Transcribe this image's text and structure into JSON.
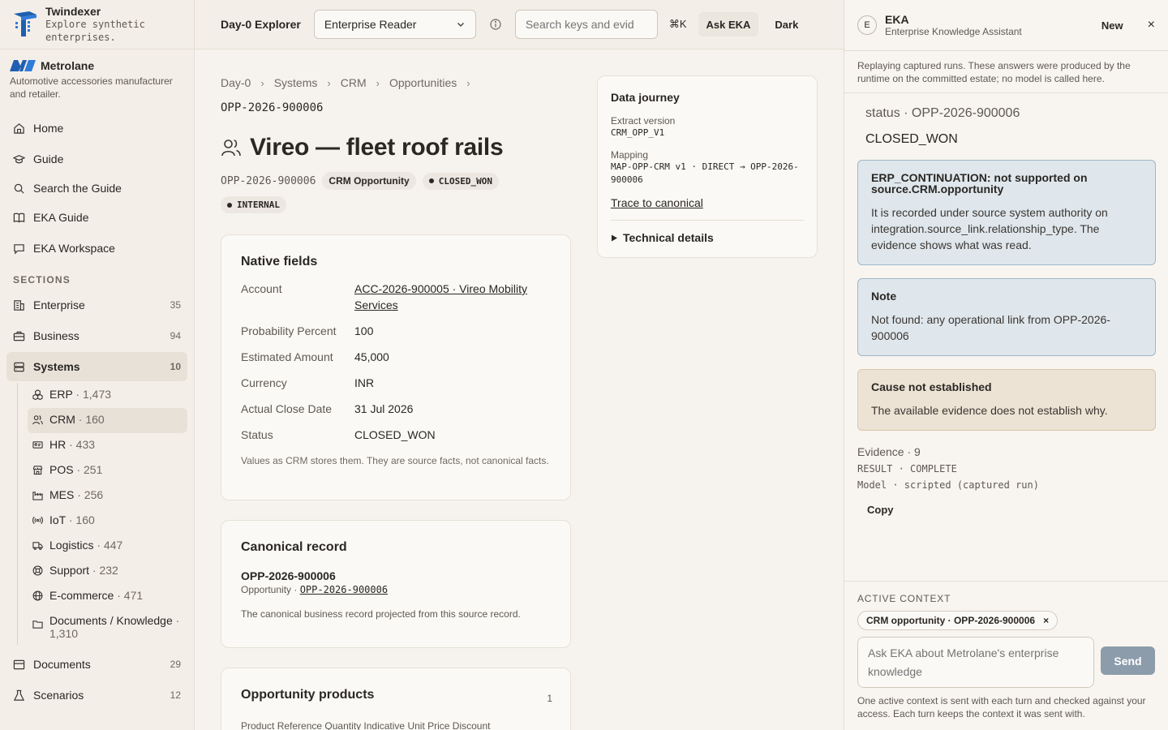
{
  "brand": {
    "name": "Twindexer",
    "tagline": "Explore synthetic enterprises."
  },
  "org": {
    "name": "Metrolane",
    "description": "Automotive accessories manufacturer and retailer."
  },
  "nav": {
    "home": "Home",
    "guide": "Guide",
    "search_guide": "Search the Guide",
    "eka_guide": "EKA Guide",
    "eka_workspace": "EKA Workspace"
  },
  "sections_label": "SECTIONS",
  "sections": [
    {
      "label": "Enterprise",
      "count": "35"
    },
    {
      "label": "Business",
      "count": "94"
    },
    {
      "label": "Systems",
      "count": "10"
    }
  ],
  "systems": [
    {
      "label": "ERP",
      "meta": " · 1,473"
    },
    {
      "label": "CRM",
      "meta": " · 160"
    },
    {
      "label": "HR",
      "meta": " · 433"
    },
    {
      "label": "POS",
      "meta": " · 251"
    },
    {
      "label": "MES",
      "meta": " · 256"
    },
    {
      "label": "IoT",
      "meta": " · 160"
    },
    {
      "label": "Logistics",
      "meta": " · 447"
    },
    {
      "label": "Support",
      "meta": " · 232"
    },
    {
      "label": "E-commerce",
      "meta": " · 471"
    },
    {
      "label": "Documents / Knowledge",
      "meta": " · 1,310"
    }
  ],
  "bottom_sections": [
    {
      "label": "Documents",
      "count": "29"
    },
    {
      "label": "Scenarios",
      "count": "12"
    }
  ],
  "topbar": {
    "title": "Day-0 Explorer",
    "persona": "Enterprise Reader",
    "search_placeholder": "Search keys and evid",
    "shortcut": "⌘K",
    "ask": "Ask EKA",
    "theme": "Dark"
  },
  "breadcrumb": [
    "Day-0",
    "Systems",
    "CRM",
    "Opportunities"
  ],
  "record_id": "OPP-2026-900006",
  "title": "Vireo — fleet roof rails",
  "meta": {
    "id": "OPP-2026-900006",
    "type": "CRM Opportunity",
    "status": "CLOSED_WON",
    "classification": "INTERNAL"
  },
  "native": {
    "heading": "Native fields",
    "fields": [
      {
        "k": "Account",
        "v": "ACC-2026-900005 · Vireo Mobility Services"
      },
      {
        "k": "Probability Percent",
        "v": "100"
      },
      {
        "k": "Estimated Amount",
        "v": "45,000"
      },
      {
        "k": "Currency",
        "v": "INR"
      },
      {
        "k": "Actual Close Date",
        "v": "31 Jul 2026"
      },
      {
        "k": "Status",
        "v": "CLOSED_WON"
      }
    ],
    "note": "Values as CRM stores them. They are source facts, not canonical facts."
  },
  "canonical": {
    "heading": "Canonical record",
    "id": "OPP-2026-900006",
    "kind": "Opportunity · ",
    "link": "OPP-2026-900006",
    "desc": "The canonical business record projected from this source record."
  },
  "products": {
    "heading": "Opportunity products",
    "count": "1",
    "columns": "Product Reference   Quantity   Indicative Unit Price   Discount"
  },
  "journey": {
    "heading": "Data journey",
    "extract_label": "Extract version",
    "extract_value": "CRM_OPP_V1",
    "mapping_label": "Mapping",
    "mapping_value": "MAP-OPP-CRM v1 · DIRECT → OPP-2026-900006",
    "trace": "Trace to canonical",
    "technical": "Technical details"
  },
  "eka": {
    "avatar": "E",
    "name": "EKA",
    "subtitle": "Enterprise Knowledge Assistant",
    "new": "New",
    "close": "×",
    "banner": "Replaying captured runs. These answers were produced by the runtime on the committed estate; no model is called here.",
    "status_label": "status · OPP-2026-900006",
    "status_value": "CLOSED_WON",
    "box1_title": "ERP_CONTINUATION: not supported on source.CRM.opportunity",
    "box1_text": "It is recorded under source system authority on integration.source_link.relationship_type. The evidence shows what was read.",
    "box2_title": "Note",
    "box2_text": "Not found: any operational link from OPP-2026-900006",
    "box3_title": "Cause not established",
    "box3_text": "The available evidence does not establish why.",
    "evidence": "Evidence · 9",
    "result": "RESULT · COMPLETE",
    "model": "Model · scripted (captured run)",
    "copy": "Copy",
    "ctx_label": "ACTIVE CONTEXT",
    "ctx_chip": "CRM opportunity · OPP-2026-900006",
    "ctx_remove": "×",
    "input_placeholder": "Ask EKA about Metrolane's enterprise knowledge",
    "send": "Send",
    "foot": "One active context is sent with each turn and checked against your access. Each turn keeps the context it was sent with."
  },
  "colors": {
    "accent": "#1f5fb0",
    "info_box": "#dfe7ec",
    "warn_box": "#ede3d4",
    "send": "#8c9cab"
  }
}
